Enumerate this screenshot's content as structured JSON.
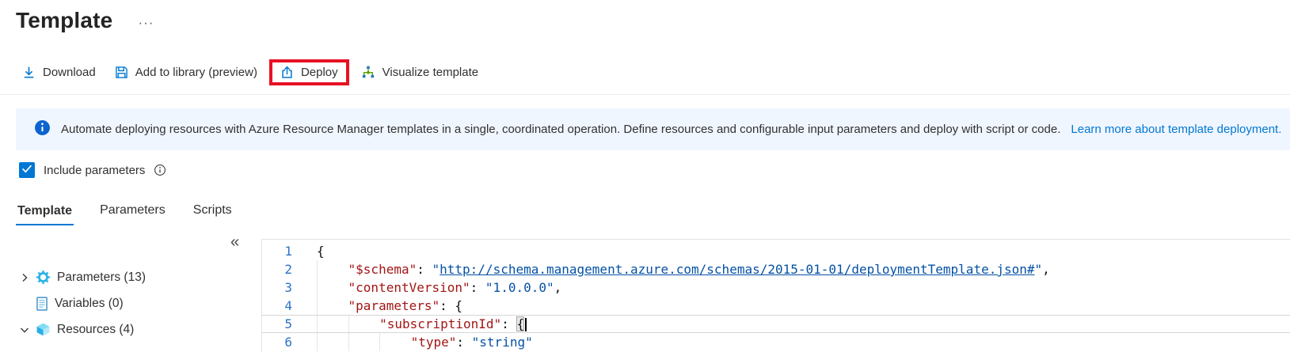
{
  "page": {
    "title": "Template",
    "more_label": "···"
  },
  "toolbar": {
    "items": [
      {
        "id": "download",
        "label": "Download",
        "icon": "download-icon",
        "highlighted": false
      },
      {
        "id": "add-to-library",
        "label": "Add to library (preview)",
        "icon": "save-icon",
        "highlighted": false
      },
      {
        "id": "deploy",
        "label": "Deploy",
        "icon": "upload-icon",
        "highlighted": true
      },
      {
        "id": "visualize-template",
        "label": "Visualize template",
        "icon": "hierarchy-icon",
        "highlighted": false
      }
    ]
  },
  "banner": {
    "icon": "info-icon",
    "text": "Automate deploying resources with Azure Resource Manager templates in a single, coordinated operation. Define resources and configurable input parameters and deploy with script or code.",
    "link_label": "Learn more about template deployment."
  },
  "include_parameters": {
    "checked": true,
    "label": "Include parameters",
    "info_icon": "info-outline-icon"
  },
  "tabs": {
    "items": [
      {
        "id": "template",
        "label": "Template",
        "active": true
      },
      {
        "id": "parameters",
        "label": "Parameters",
        "active": false
      },
      {
        "id": "scripts",
        "label": "Scripts",
        "active": false
      }
    ]
  },
  "tree": {
    "collapse_label": "«",
    "items": [
      {
        "id": "parameters",
        "label": "Parameters (13)",
        "chevron": "right",
        "icon": "gear-icon"
      },
      {
        "id": "variables",
        "label": "Variables (0)",
        "chevron": "none",
        "icon": "document-icon"
      },
      {
        "id": "resources",
        "label": "Resources (4)",
        "chevron": "down",
        "icon": "cube-icon"
      }
    ]
  },
  "editor": {
    "lines": [
      {
        "num": "1",
        "current": false,
        "tokens": [
          [
            "p",
            "{"
          ]
        ]
      },
      {
        "num": "2",
        "current": false,
        "tokens": [
          [
            "g",
            ""
          ],
          [
            "w",
            "    "
          ],
          [
            "k",
            "\"$schema\""
          ],
          [
            "p",
            ": "
          ],
          [
            "s",
            "\""
          ],
          [
            "u",
            "http://schema.management.azure.com/schemas/2015-01-01/deploymentTemplate.json#"
          ],
          [
            "s",
            "\""
          ],
          [
            "p",
            ","
          ]
        ]
      },
      {
        "num": "3",
        "current": false,
        "tokens": [
          [
            "g",
            ""
          ],
          [
            "w",
            "    "
          ],
          [
            "k",
            "\"contentVersion\""
          ],
          [
            "p",
            ": "
          ],
          [
            "s",
            "\"1.0.0.0\""
          ],
          [
            "p",
            ","
          ]
        ]
      },
      {
        "num": "4",
        "current": false,
        "tokens": [
          [
            "g",
            ""
          ],
          [
            "w",
            "    "
          ],
          [
            "k",
            "\"parameters\""
          ],
          [
            "p",
            ": "
          ],
          [
            "p",
            "{"
          ]
        ]
      },
      {
        "num": "5",
        "current": true,
        "tokens": [
          [
            "g",
            ""
          ],
          [
            "w",
            "    "
          ],
          [
            "g",
            ""
          ],
          [
            "w",
            "    "
          ],
          [
            "k",
            "\"subscriptionId\""
          ],
          [
            "p",
            ": "
          ],
          [
            "bm",
            "{"
          ],
          [
            "cur",
            ""
          ]
        ]
      },
      {
        "num": "6",
        "current": false,
        "tokens": [
          [
            "g",
            ""
          ],
          [
            "w",
            "    "
          ],
          [
            "g",
            ""
          ],
          [
            "w",
            "    "
          ],
          [
            "g",
            ""
          ],
          [
            "w",
            "    "
          ],
          [
            "k",
            "\"type\""
          ],
          [
            "p",
            ": "
          ],
          [
            "s",
            "\"string\""
          ]
        ]
      }
    ]
  },
  "colors": {
    "accent": "#0078d4",
    "highlight_box": "#e81123",
    "banner_bg": "#f0f6ff",
    "code_key": "#a31515",
    "code_string": "#0451a5",
    "line_number": "#2c72c8"
  }
}
